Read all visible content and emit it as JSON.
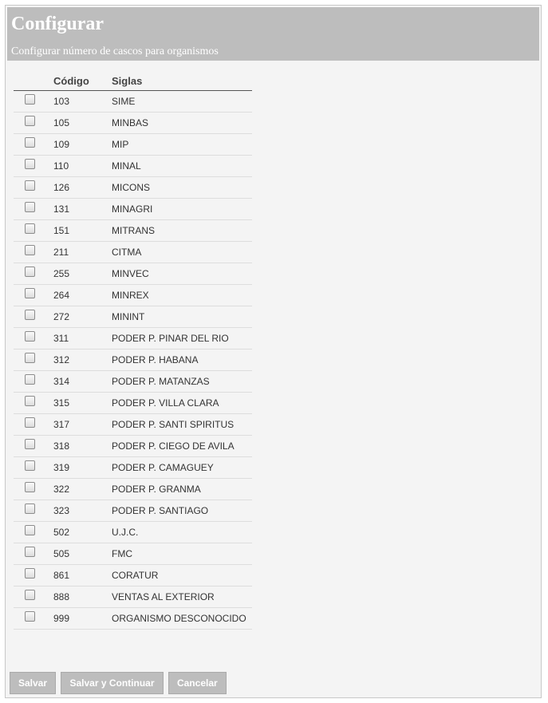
{
  "header": {
    "title": "Configurar",
    "subtitle": "Configurar número de cascos para organismos"
  },
  "table": {
    "columns": [
      "Código",
      "Siglas"
    ],
    "rows": [
      {
        "code": "103",
        "siglas": "SIME",
        "checked": false
      },
      {
        "code": "105",
        "siglas": "MINBAS",
        "checked": false
      },
      {
        "code": "109",
        "siglas": "MIP",
        "checked": false
      },
      {
        "code": "110",
        "siglas": "MINAL",
        "checked": false
      },
      {
        "code": "126",
        "siglas": "MICONS",
        "checked": false
      },
      {
        "code": "131",
        "siglas": "MINAGRI",
        "checked": false
      },
      {
        "code": "151",
        "siglas": "MITRANS",
        "checked": false
      },
      {
        "code": "211",
        "siglas": "CITMA",
        "checked": false
      },
      {
        "code": "255",
        "siglas": "MINVEC",
        "checked": false
      },
      {
        "code": "264",
        "siglas": "MINREX",
        "checked": false
      },
      {
        "code": "272",
        "siglas": "MININT",
        "checked": false
      },
      {
        "code": "311",
        "siglas": "PODER P. PINAR DEL RIO",
        "checked": false
      },
      {
        "code": "312",
        "siglas": "PODER P. HABANA",
        "checked": false
      },
      {
        "code": "314",
        "siglas": "PODER P. MATANZAS",
        "checked": false
      },
      {
        "code": "315",
        "siglas": "PODER P. VILLA CLARA",
        "checked": false
      },
      {
        "code": "317",
        "siglas": "PODER P. SANTI SPIRITUS",
        "checked": false
      },
      {
        "code": "318",
        "siglas": "PODER P. CIEGO DE AVILA",
        "checked": false
      },
      {
        "code": "319",
        "siglas": "PODER P. CAMAGUEY",
        "checked": false
      },
      {
        "code": "322",
        "siglas": "PODER P. GRANMA",
        "checked": false
      },
      {
        "code": "323",
        "siglas": "PODER P. SANTIAGO",
        "checked": false
      },
      {
        "code": "502",
        "siglas": "U.J.C.",
        "checked": false
      },
      {
        "code": "505",
        "siglas": "FMC",
        "checked": false
      },
      {
        "code": "861",
        "siglas": "CORATUR",
        "checked": false
      },
      {
        "code": "888",
        "siglas": "VENTAS AL EXTERIOR",
        "checked": false
      },
      {
        "code": "999",
        "siglas": "ORGANISMO DESCONOCIDO",
        "checked": false
      }
    ]
  },
  "buttons": {
    "save": "Salvar",
    "save_continue": "Salvar y Continuar",
    "cancel": "Cancelar"
  }
}
